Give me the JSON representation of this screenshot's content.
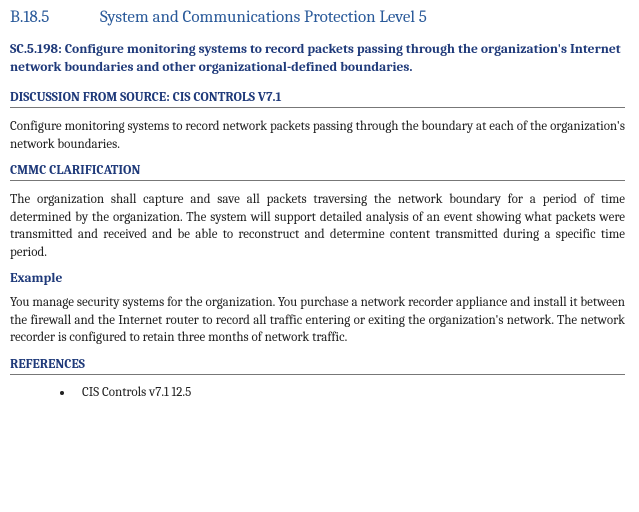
{
  "title": {
    "number": "B.18.5",
    "text": "System and Communications Protection Level 5"
  },
  "requirement": "SC.5.198: Configure monitoring systems to record packets passing through the organization's Internet network boundaries and other organizational-defined boundaries.",
  "discussion": {
    "label": "DISCUSSION FROM SOURCE: CIS CONTROLS V7.1",
    "text": "Configure monitoring systems to record network packets passing through the boundary at each of the organization's network boundaries."
  },
  "clarification": {
    "label": "CMMC CLARIFICATION",
    "text": "The organization shall capture and save all packets traversing the network boundary for a period of time determined by the organization.  The system will support detailed analysis of an event showing what packets were transmitted and received and be able to reconstruct and determine content transmitted during a specific time period."
  },
  "example": {
    "label": "Example",
    "text": "You manage security systems for the organization.  You purchase a network recorder appliance and install it between the firewall and the Internet router to record all traffic entering or exiting the organization's network.  The network recorder is configured to retain three months of network traffic."
  },
  "references": {
    "label": "REFERENCES",
    "items": [
      "CIS Controls v7.1 12.5"
    ]
  }
}
